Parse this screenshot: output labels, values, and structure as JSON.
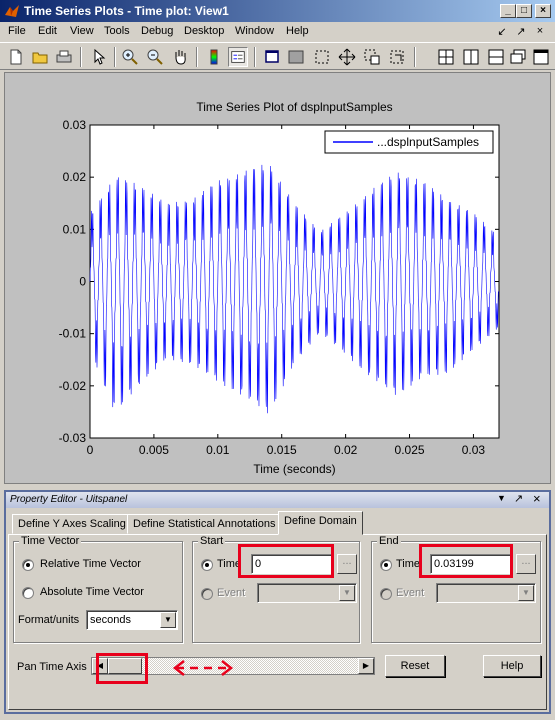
{
  "window": {
    "title": "Time Series Plots - Time plot: View1",
    "controls": [
      "minimize",
      "maximize",
      "close"
    ]
  },
  "menu": {
    "items": [
      {
        "label": "File"
      },
      {
        "label": "Edit"
      },
      {
        "label": "View"
      },
      {
        "label": "Tools"
      },
      {
        "label": "Debug"
      },
      {
        "label": "Desktop"
      },
      {
        "label": "Window"
      },
      {
        "label": "Help"
      }
    ],
    "right_icons": [
      "undock-arrow-icon",
      "dock-arrow-icon",
      "close-icon"
    ]
  },
  "toolbar": {
    "icons": [
      "new-file-icon",
      "open-folder-icon",
      "print-icon",
      "pointer-icon",
      "zoom-in-icon",
      "zoom-out-icon",
      "pan-hand-icon",
      "colorbar-icon",
      "legend-icon",
      "single-view-icon",
      "plot-area-icon",
      "select-region-icon",
      "move-icon",
      "zoom-box-icon",
      "data-tip-icon",
      "tile-grid-icon",
      "tile-columns-icon",
      "tile-rows-icon",
      "restore-window-icon",
      "maximize-window-icon"
    ]
  },
  "chart_data": {
    "type": "line",
    "title": "Time Series Plot of dsplnputSamples",
    "xlabel": "Time (seconds)",
    "ylabel": "",
    "xlim": [
      0,
      0.032
    ],
    "ylim": [
      -0.03,
      0.03
    ],
    "xticks": [
      "0",
      "0.005",
      "0.01",
      "0.015",
      "0.02",
      "0.025",
      "0.03"
    ],
    "yticks": [
      "0.03",
      "0.02",
      "0.01",
      "0",
      "-0.01",
      "-0.02",
      "-0.03"
    ],
    "legend": {
      "label": "...dsplnputSamples",
      "placement": "top-right"
    },
    "series": [
      {
        "name": "...dsplnputSamples",
        "color": "#0000ff",
        "x": [
          0,
          0.002,
          0.004,
          0.006,
          0.008,
          0.01,
          0.012,
          0.014,
          0.016,
          0.018,
          0.02,
          0.022,
          0.024,
          0.026,
          0.028,
          0.03,
          0.032
        ],
        "upper_envelope": [
          0.015,
          0.023,
          0.021,
          0.017,
          0.018,
          0.022,
          0.024,
          0.026,
          0.017,
          0.011,
          0.015,
          0.02,
          0.024,
          0.022,
          0.018,
          0.015,
          0.01
        ],
        "lower_envelope": [
          -0.015,
          -0.029,
          -0.022,
          -0.017,
          -0.018,
          -0.022,
          -0.025,
          -0.029,
          -0.018,
          -0.011,
          -0.016,
          -0.021,
          -0.025,
          -0.021,
          -0.02,
          -0.015,
          -0.01
        ]
      }
    ]
  },
  "property_editor": {
    "title": "Property Editor - Uitspanel",
    "header_icons": [
      "dock-menu-icon",
      "undock-icon",
      "close-icon"
    ],
    "tabs": [
      {
        "label": "Define Y Axes Scaling",
        "active": false
      },
      {
        "label": "Define Statistical Annotations",
        "active": false
      },
      {
        "label": "Define Domain",
        "active": true
      }
    ],
    "time_vector": {
      "title": "Time Vector",
      "relative_label": "Relative Time Vector",
      "relative_checked": true,
      "absolute_label": "Absolute Time Vector",
      "absolute_checked": false,
      "format_label": "Format/units",
      "format_value": "seconds"
    },
    "start": {
      "title": "Start",
      "time_label": "Time",
      "time_value": "0",
      "time_checked": true,
      "event_label": "Event",
      "event_checked": false,
      "browse_label": "..."
    },
    "end": {
      "title": "End",
      "time_label": "Time",
      "time_value": "0.03199",
      "time_checked": true,
      "event_label": "Event",
      "event_checked": false,
      "browse_label": "..."
    },
    "pan": {
      "label": "Pan Time Axis",
      "slider_position": 0
    },
    "reset_label": "Reset",
    "help_label": "Help"
  },
  "annotation_color": "#e8001c"
}
